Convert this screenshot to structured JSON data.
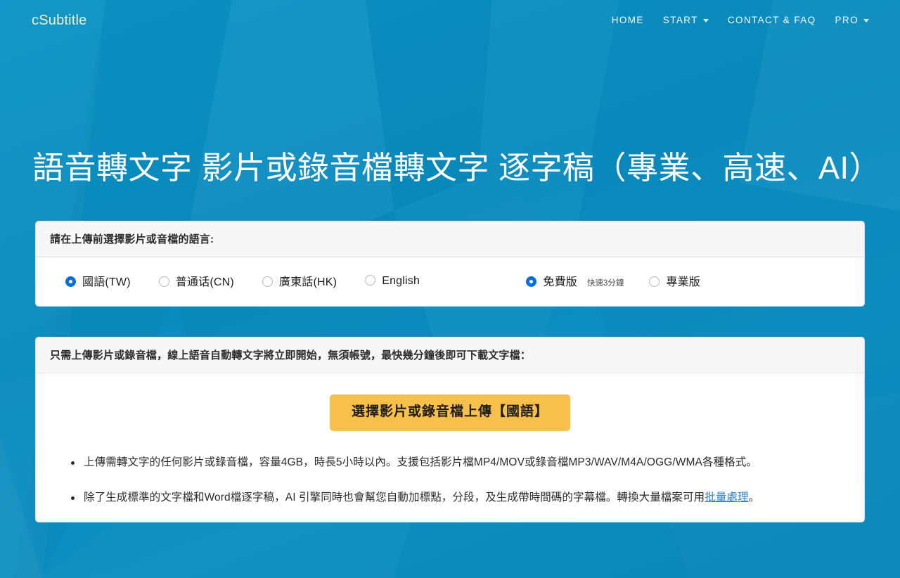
{
  "brand": {
    "logo": "cSubtitle"
  },
  "nav": {
    "items": [
      {
        "label": "HOME",
        "caret": false
      },
      {
        "label": "START",
        "caret": true
      },
      {
        "label": "CONTACT & FAQ",
        "caret": false
      },
      {
        "label": "PRO",
        "caret": true
      }
    ]
  },
  "hero": {
    "headline": "語音轉文字 影片或錄音檔轉文字 逐字稿（專業、高速、AI）"
  },
  "language_card": {
    "header": "請在上傳前選擇影片或音檔的語言:",
    "language_options": [
      {
        "label": "國語(TW)",
        "selected": true
      },
      {
        "label": "普通话(CN)",
        "selected": false
      },
      {
        "label": "廣東話(HK)",
        "selected": false
      },
      {
        "label": "English",
        "selected": false
      }
    ],
    "plan_options": [
      {
        "label": "免費版",
        "note": "快速3分鐘",
        "selected": true
      },
      {
        "label": "專業版",
        "note": "",
        "selected": false
      }
    ]
  },
  "upload_card": {
    "header": "只需上傳影片或錄音檔，線上語音自動轉文字將立即開始，無須帳號，最快幾分鐘後即可下載文字檔：",
    "button_label": "選擇影片或錄音檔上傳【國語】",
    "bullets": [
      {
        "before": "上傳需轉文字的任何影片或錄音檔，容量4GB，時長5小時以內。支援包括影片檔MP4/MOV或錄音檔MP3/WAV/M4A/OGG/WMA各種格式。",
        "link": "",
        "after": ""
      },
      {
        "before": "除了生成標準的文字檔和Word檔逐字稿，AI 引擎同時也會幫您自動加標點，分段，及生成帶時間碼的字幕檔。轉換大量檔案可用",
        "link": "批量處理",
        "after": "。"
      }
    ]
  },
  "colors": {
    "page_background": "#0b8cc0",
    "logo": "#f2eec7",
    "accent_button": "#f7c04a",
    "radio_selected": "#0a6ed8",
    "link": "#2a7fd0"
  }
}
